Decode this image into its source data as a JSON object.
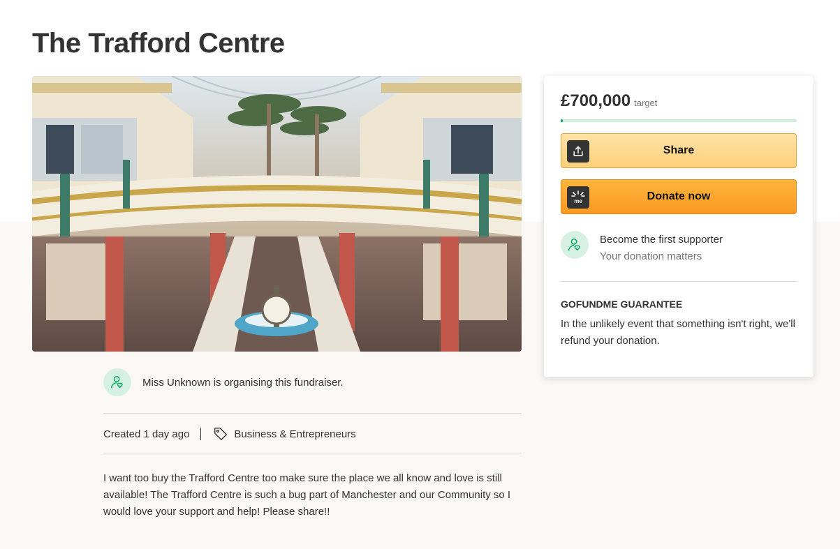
{
  "page": {
    "title": "The Trafford Centre"
  },
  "hero_image": {
    "alt": "The Trafford Centre"
  },
  "organiser": {
    "text": "Miss Unknown is organising this fundraiser."
  },
  "meta": {
    "created": "Created 1 day ago",
    "category": "Business & Entrepreneurs"
  },
  "story": {
    "text": "I want too buy the Trafford Centre too make sure the place we all know and love is still available! The Trafford Centre is such a bug part of Manchester and our Community so I would love your support and help! Please share!!"
  },
  "donation_card": {
    "amount": "£700,000",
    "target_label": "target",
    "progress_fraction": 0.01,
    "share_label": "Share",
    "donate_label": "Donate now",
    "supporter_main": "Become the first supporter",
    "supporter_sub": "Your donation matters",
    "guarantee_title": "GOFUNDME GUARANTEE",
    "guarantee_text": "In the unlikely event that something isn't right, we'll refund your donation."
  },
  "colors": {
    "brand_green": "#02a95c",
    "avatar_bg": "#d6f1e4",
    "share_button": "#fcd07a",
    "donate_button": "#f99a24"
  },
  "icons": {
    "organiser_avatar": "user-heart-icon",
    "category": "tag-icon",
    "share": "share-upload-icon",
    "donate": "gofundme-me-icon",
    "supporter": "user-heart-icon"
  }
}
